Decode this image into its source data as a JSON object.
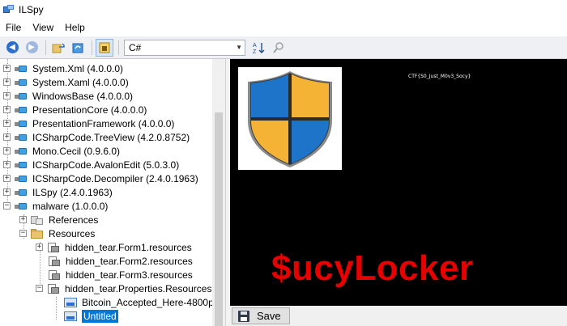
{
  "window": {
    "title": "ILSpy"
  },
  "menu": [
    "File",
    "View",
    "Help"
  ],
  "toolbar": {
    "language": "C#",
    "icons": [
      "back-icon",
      "forward-icon",
      "open-icon",
      "refresh-icon",
      "private-members-icon",
      "language-select",
      "sort-icon",
      "search-icon"
    ]
  },
  "tree": {
    "items": [
      {
        "label": "System.Xml (4.0.0.0)",
        "indent": 0,
        "expander": "+",
        "icon": "assembly"
      },
      {
        "label": "System.Xaml (4.0.0.0)",
        "indent": 0,
        "expander": "+",
        "icon": "assembly"
      },
      {
        "label": "WindowsBase (4.0.0.0)",
        "indent": 0,
        "expander": "+",
        "icon": "assembly"
      },
      {
        "label": "PresentationCore (4.0.0.0)",
        "indent": 0,
        "expander": "+",
        "icon": "assembly"
      },
      {
        "label": "PresentationFramework (4.0.0.0)",
        "indent": 0,
        "expander": "+",
        "icon": "assembly"
      },
      {
        "label": "ICSharpCode.TreeView (4.2.0.8752)",
        "indent": 0,
        "expander": "+",
        "icon": "assembly"
      },
      {
        "label": "Mono.Cecil (0.9.6.0)",
        "indent": 0,
        "expander": "+",
        "icon": "assembly"
      },
      {
        "label": "ICSharpCode.AvalonEdit (5.0.3.0)",
        "indent": 0,
        "expander": "+",
        "icon": "assembly"
      },
      {
        "label": "ICSharpCode.Decompiler (2.4.0.1963)",
        "indent": 0,
        "expander": "+",
        "icon": "assembly"
      },
      {
        "label": "ILSpy (2.4.0.1963)",
        "indent": 0,
        "expander": "+",
        "icon": "assembly"
      },
      {
        "label": "malware (1.0.0.0)",
        "indent": 0,
        "expander": "−",
        "icon": "assembly"
      },
      {
        "label": "References",
        "indent": 1,
        "expander": "+",
        "icon": "references"
      },
      {
        "label": "Resources",
        "indent": 1,
        "expander": "−",
        "icon": "folder"
      },
      {
        "label": "hidden_tear.Form1.resources",
        "indent": 2,
        "expander": "+",
        "icon": "resource"
      },
      {
        "label": "hidden_tear.Form2.resources",
        "indent": 2,
        "expander": "",
        "icon": "resource"
      },
      {
        "label": "hidden_tear.Form3.resources",
        "indent": 2,
        "expander": "",
        "icon": "resource"
      },
      {
        "label": "hidden_tear.Properties.Resources",
        "indent": 2,
        "expander": "−",
        "icon": "resource"
      },
      {
        "label": "Bitcoin_Accepted_Here-4800p",
        "indent": 3,
        "expander": "",
        "icon": "image"
      },
      {
        "label": "Untitled",
        "indent": 3,
        "expander": "",
        "icon": "image",
        "selected": true
      }
    ]
  },
  "viewer": {
    "ctf_text": "CTF{S0_Just_M0v3_Socy}",
    "banner_text": "$ucyLocker",
    "shield_colors": [
      "#1d74c8",
      "#f5b335",
      "#f5b335",
      "#1d74c8"
    ],
    "banner_color": "#e60000"
  },
  "save_button": {
    "label": "Save"
  }
}
